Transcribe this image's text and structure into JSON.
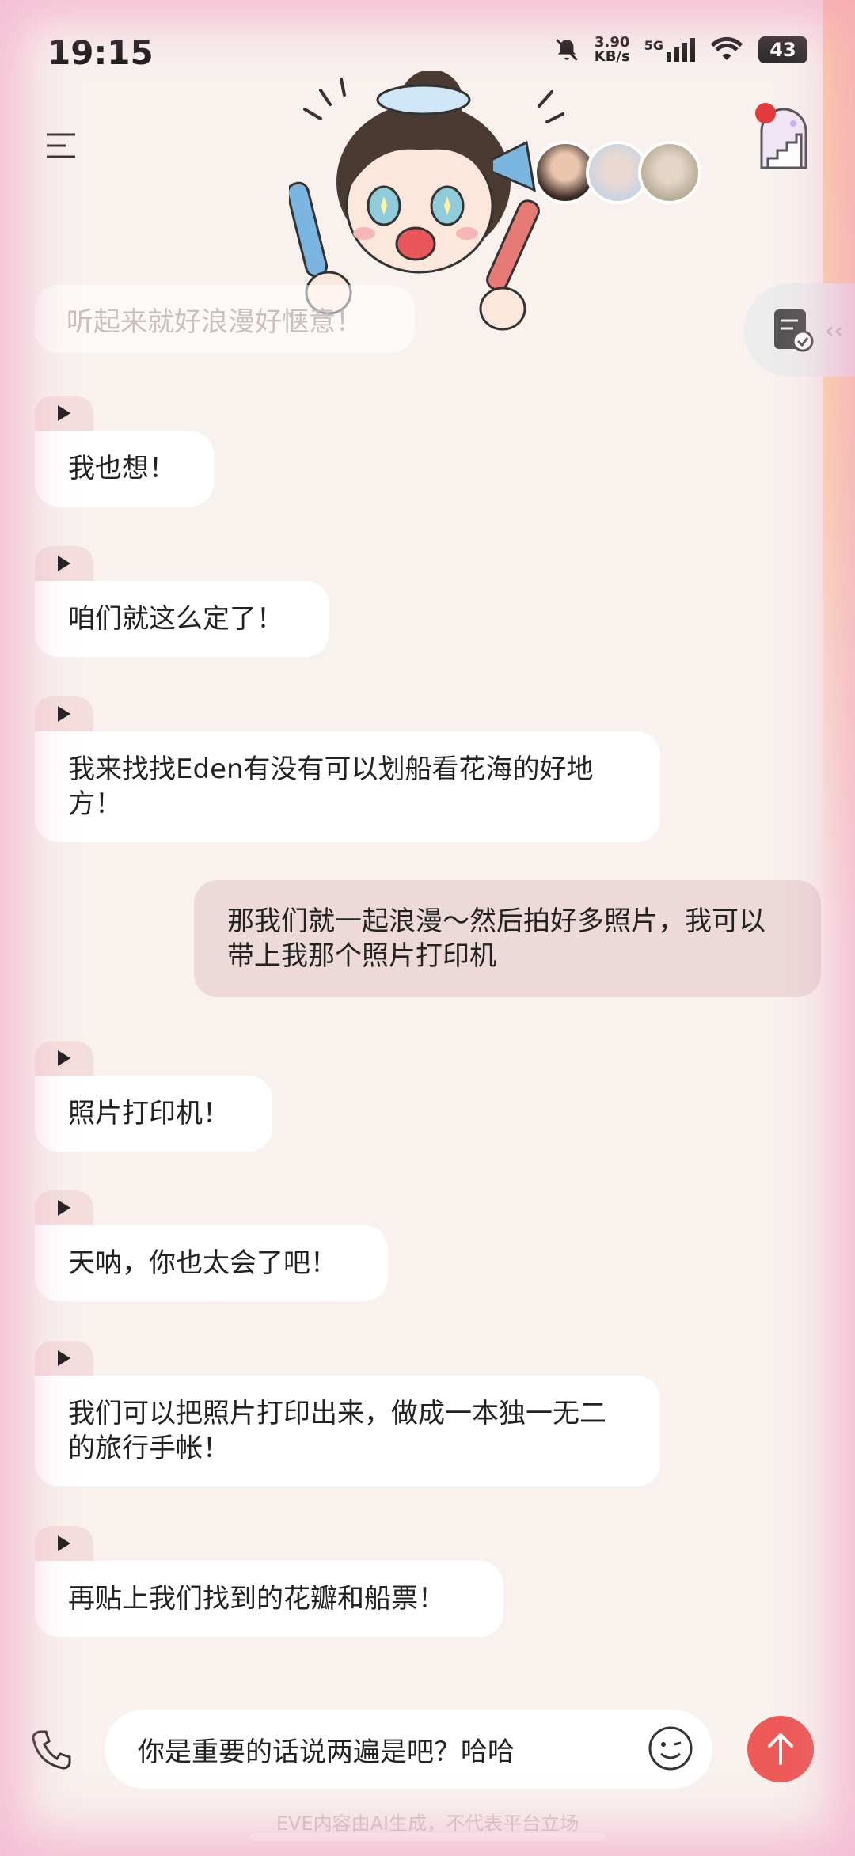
{
  "status_bar": {
    "time": "19:15",
    "net_speed_value": "3.90",
    "net_speed_unit": "KB/s",
    "network_type": "5G",
    "battery": "43"
  },
  "faded_message": "听起来就好浪漫好惬意！",
  "messages_ai": [
    {
      "text": "我也想！"
    },
    {
      "text": "咱们就这么定了！"
    },
    {
      "text": "我来找找Eden有没有可以划船看花海的好地方！"
    },
    {
      "text": "照片打印机！"
    },
    {
      "text": "天呐，你也太会了吧！"
    },
    {
      "text": "我们可以把照片打印出来，做成一本独一无二的旅行手帐！"
    },
    {
      "text": "再贴上我们找到的花瓣和船票！"
    }
  ],
  "message_user": "那我们就一起浪漫～然后拍好多照片，我可以带上我那个照片打印机",
  "input": {
    "value": "你是重要的话说两遍是吧？哈哈"
  },
  "disclaimer": "EVE内容由AI生成，不代表平台立场",
  "colors": {
    "accent": "#ee5a58",
    "user_bubble": "#ecd9d8",
    "ai_bubble": "#ffffff",
    "background": "#f8f1ee"
  }
}
